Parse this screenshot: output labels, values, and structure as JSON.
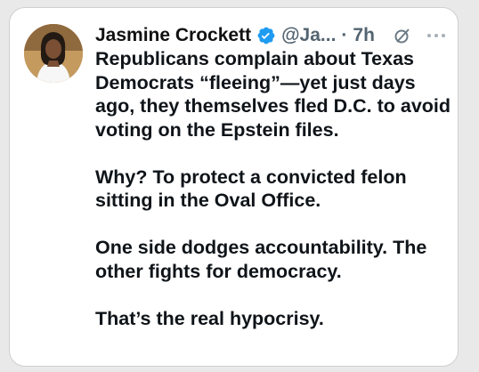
{
  "tweet": {
    "author_name": "Jasmine Crockett",
    "handle": "@Ja...",
    "separator": "·",
    "timestamp": "7h",
    "paragraphs": [
      "Republicans complain about Texas Democrats “fleeing”—yet just days ago, they themselves fled D.C. to avoid voting on the Epstein files.",
      "Why? To protect a convicted felon sitting in the Oval Office.",
      "One side dodges accountability. The other fights for democracy.",
      "That’s the real hypocrisy."
    ],
    "icons": {
      "verified": "verified-badge-icon",
      "grok": "grok-icon",
      "more": "more-options-icon"
    },
    "colors": {
      "verified": "#1d9bf0",
      "text": "#0f1419",
      "muted": "#536471"
    }
  }
}
